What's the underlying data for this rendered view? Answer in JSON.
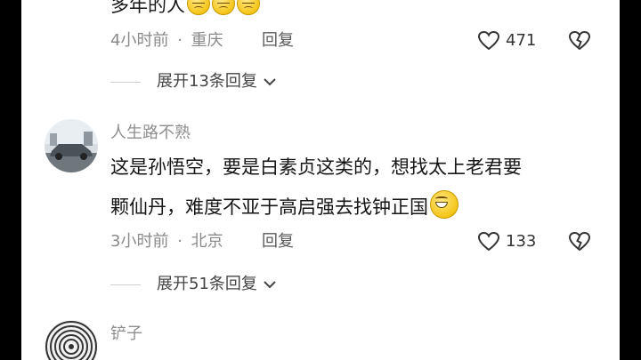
{
  "comments": [
    {
      "text_tail": "多年的人",
      "emoji": [
        "disappointed-emoji",
        "disappointed-emoji",
        "disappointed-emoji"
      ],
      "time": "4小时前",
      "separator": "·",
      "location": "重庆",
      "reply_label": "回复",
      "likes": "471",
      "expand_label": "展开13条回复"
    },
    {
      "username": "人生路不熟",
      "text_line1": "这是孙悟空，要是白素贞这类的，想找太上老君要",
      "text_line2": "颗仙丹，难度不亚于高启强去找钟正国",
      "emoji": "grinning-emoji",
      "time": "3小时前",
      "separator": "·",
      "location": "北京",
      "reply_label": "回复",
      "likes": "133",
      "expand_label": "展开51条回复"
    },
    {
      "username": "铲子"
    }
  ],
  "colors": {
    "page_bg": "#ffffff",
    "outer_bg": "#000000",
    "text": "#161616",
    "meta": "#8a8a8a"
  },
  "icons": {
    "like": "heart-outline-icon",
    "dislike": "broken-heart-icon",
    "expand": "chevron-down-icon"
  }
}
